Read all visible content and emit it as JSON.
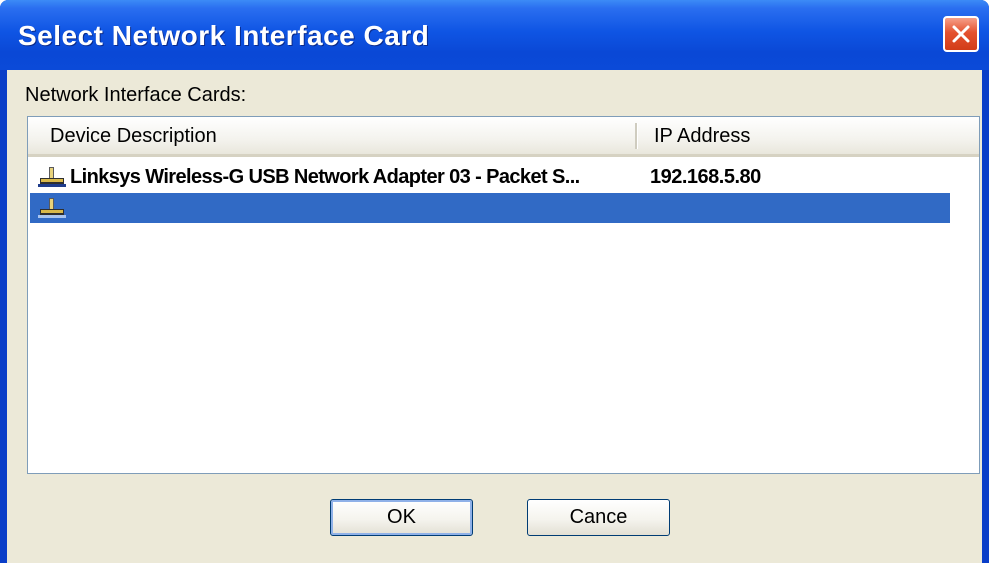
{
  "window": {
    "title": "Select Network Interface Card"
  },
  "group": {
    "label": "Network Interface Cards:"
  },
  "table": {
    "columns": [
      "Device Description",
      "IP Address"
    ],
    "rows": [
      {
        "description": "Linksys Wireless-G USB Network Adapter 03 - Packet S...",
        "ip": "192.168.5.80",
        "selected": false
      },
      {
        "description": "",
        "ip": "",
        "selected": true
      }
    ]
  },
  "buttons": {
    "ok": "OK",
    "cancel": "Cance"
  },
  "colors": {
    "titlebar": "#0a48d6",
    "selection": "#316ac5",
    "face": "#ece9d8",
    "close": "#e4522f"
  },
  "icons": {
    "row_icon": "network-adapter-icon",
    "close": "close-icon"
  }
}
